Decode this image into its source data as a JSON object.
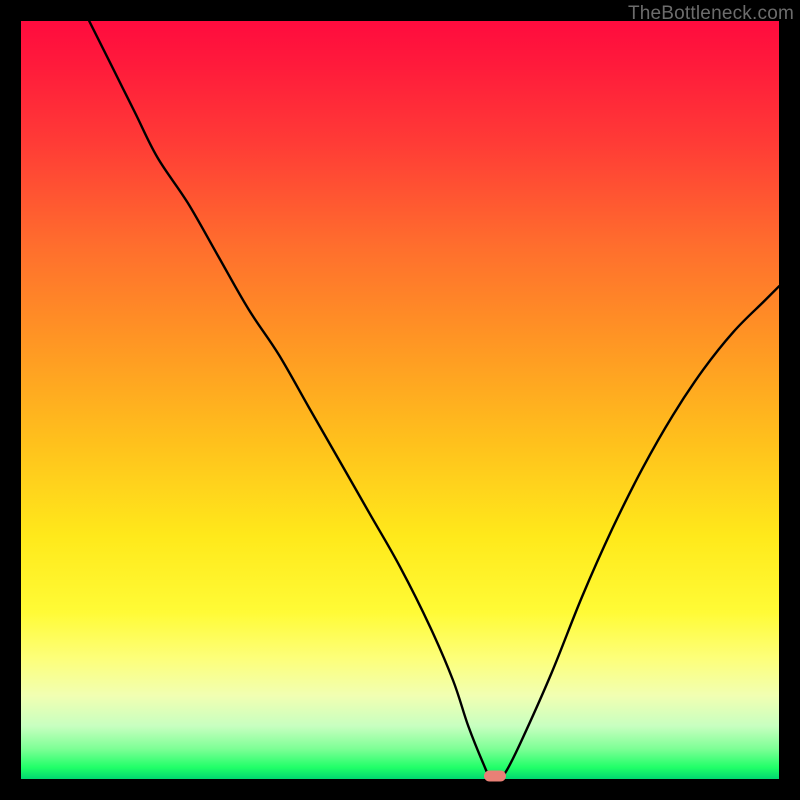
{
  "watermark": "TheBottleneck.com",
  "colors": {
    "frame": "#000000",
    "curve": "#000000",
    "marker": "#e98076"
  },
  "chart_data": {
    "type": "line",
    "title": "",
    "xlabel": "",
    "ylabel": "",
    "xlim": [
      0,
      100
    ],
    "ylim": [
      0,
      100
    ],
    "grid": false,
    "legend": false,
    "note": "Axes are implicit (no tick labels); values are estimated as percentages of plot width/height. Higher y = higher bottleneck. Minimum (optimal point) near x≈62.",
    "series": [
      {
        "name": "bottleneck-curve",
        "x": [
          9,
          12,
          15,
          18,
          22,
          26,
          30,
          34,
          38,
          42,
          46,
          50,
          54,
          57,
          59,
          61,
          62,
          63,
          64,
          66,
          70,
          74,
          78,
          82,
          86,
          90,
          94,
          98,
          100
        ],
        "y": [
          100,
          94,
          88,
          82,
          76,
          69,
          62,
          56,
          49,
          42,
          35,
          28,
          20,
          13,
          7,
          2,
          0,
          0,
          1,
          5,
          14,
          24,
          33,
          41,
          48,
          54,
          59,
          63,
          65
        ]
      }
    ],
    "marker": {
      "x": 62.5,
      "y": 0
    }
  }
}
